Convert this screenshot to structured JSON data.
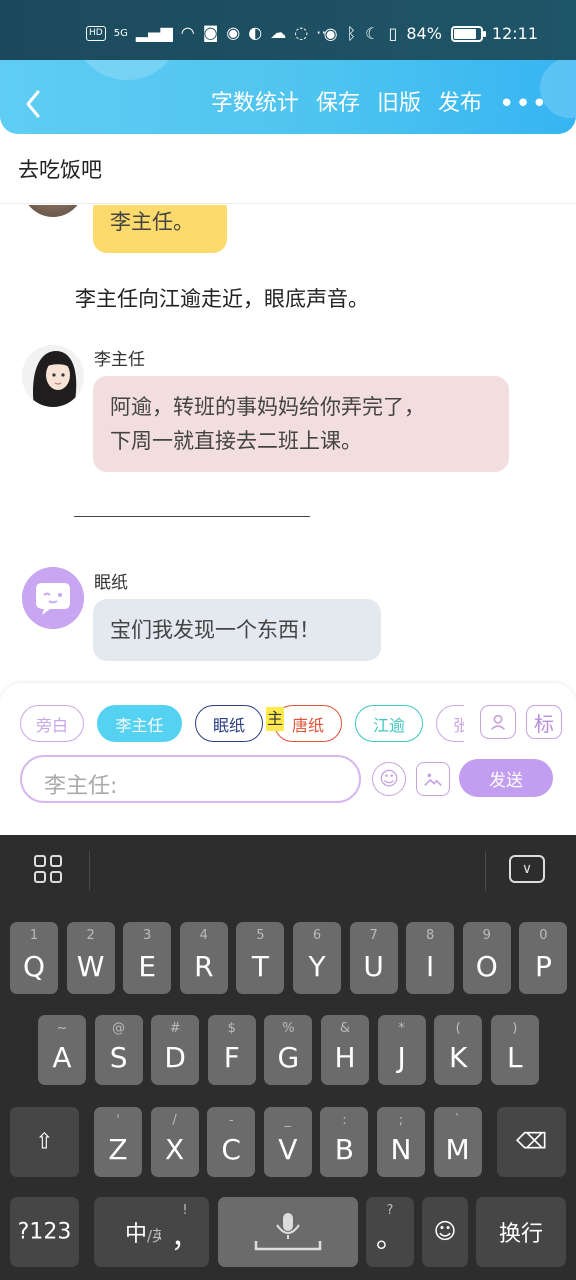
{
  "status_bar": {
    "hd_label": "HD",
    "network": "5G",
    "battery_percent": "84%",
    "battery_level": 0.84,
    "time": "12:11",
    "icons_left": [
      "hd-icon",
      "signal-icon",
      "wifi-icon",
      "app-icon",
      "qq-icon",
      "browser-icon",
      "cloud-icon",
      "wechat-icon",
      "more-dots-icon"
    ],
    "icons_right": [
      "eye-icon",
      "bluetooth-icon",
      "moon-icon",
      "vibrate-icon",
      "battery-icon"
    ]
  },
  "header": {
    "actions": [
      "字数统计",
      "保存",
      "旧版",
      "发布"
    ],
    "more_label": "•••"
  },
  "title_bar": {
    "title": "去吃饭吧"
  },
  "chat": {
    "partial_bubble": {
      "text": "李主任。"
    },
    "narration": "李主任向江逾走近，眼底声音。",
    "message_1": {
      "speaker": "李主任",
      "line1": "阿逾，转班的事妈妈给你弄完了，",
      "line2": "下周一就直接去二班上课。"
    },
    "divider": "———————————————",
    "message_2": {
      "speaker": "眠纸",
      "text": "宝们我发现一个东西！"
    }
  },
  "panel": {
    "chips": [
      "旁白",
      "李主任",
      "眠纸",
      "唐纸",
      "江逾",
      "张"
    ],
    "highlight_char": "主",
    "tag_button": "标",
    "input_placeholder": "李主任:",
    "send_label": "发送"
  },
  "keyboard": {
    "row1": [
      {
        "k": "Q",
        "s": "1"
      },
      {
        "k": "W",
        "s": "2"
      },
      {
        "k": "E",
        "s": "3"
      },
      {
        "k": "R",
        "s": "4"
      },
      {
        "k": "T",
        "s": "5"
      },
      {
        "k": "Y",
        "s": "6"
      },
      {
        "k": "U",
        "s": "7"
      },
      {
        "k": "I",
        "s": "8"
      },
      {
        "k": "O",
        "s": "9"
      },
      {
        "k": "P",
        "s": "0"
      }
    ],
    "row2": [
      {
        "k": "A",
        "s": "~"
      },
      {
        "k": "S",
        "s": "@"
      },
      {
        "k": "D",
        "s": "#"
      },
      {
        "k": "F",
        "s": "$"
      },
      {
        "k": "G",
        "s": "%"
      },
      {
        "k": "H",
        "s": "&"
      },
      {
        "k": "J",
        "s": "*"
      },
      {
        "k": "K",
        "s": "("
      },
      {
        "k": "L",
        "s": ")"
      }
    ],
    "row3": [
      {
        "k": "Z",
        "s": "'"
      },
      {
        "k": "X",
        "s": "/"
      },
      {
        "k": "C",
        "s": "-"
      },
      {
        "k": "V",
        "s": "_"
      },
      {
        "k": "B",
        "s": ":"
      },
      {
        "k": "N",
        "s": ";"
      },
      {
        "k": "M",
        "s": "`"
      }
    ],
    "symbols_label": "?123",
    "lang_main": "中",
    "lang_sub": "/英",
    "comma_label": "，",
    "comma_sub": "!",
    "period_label": "。",
    "period_sub": "?",
    "enter_label": "换行"
  }
}
